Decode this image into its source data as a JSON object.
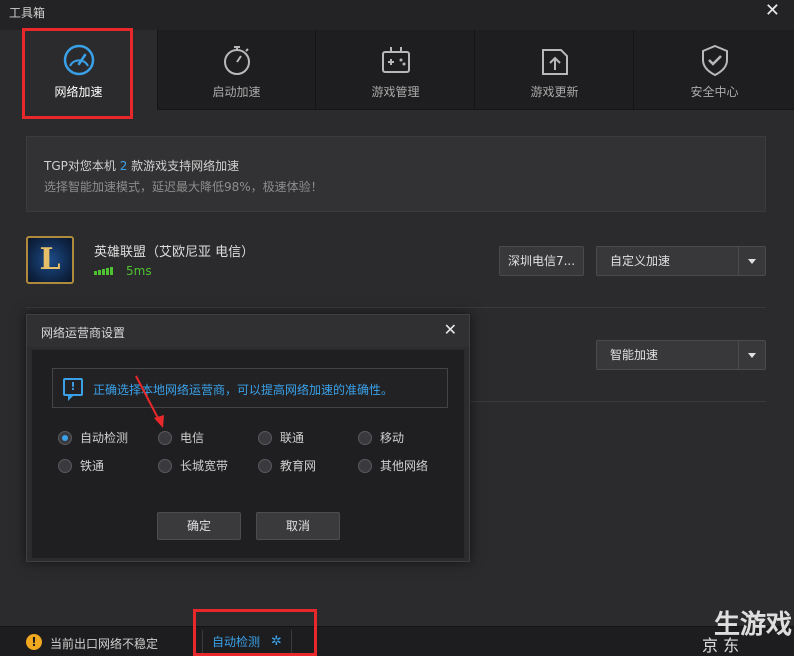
{
  "window": {
    "title": "工具箱"
  },
  "tabs": [
    {
      "label": "网络加速",
      "icon": "speedometer-icon",
      "active": true
    },
    {
      "label": "启动加速",
      "icon": "stopwatch-icon",
      "active": false
    },
    {
      "label": "游戏管理",
      "icon": "gamepad-icon",
      "active": false
    },
    {
      "label": "游戏更新",
      "icon": "upload-box-icon",
      "active": false
    },
    {
      "label": "安全中心",
      "icon": "shield-check-icon",
      "active": false
    }
  ],
  "notice": {
    "line1_prefix": "TGP对您本机",
    "line1_count": "2",
    "line1_suffix": "款游戏支持网络加速",
    "line2": "选择智能加速模式，延迟最大降低98%，极速体验！"
  },
  "games": [
    {
      "name": "英雄联盟（艾欧尼亚 电信）",
      "icon_letter": "L",
      "ping": "5ms",
      "signal_bars": 5,
      "server_button": "深圳电信7...",
      "mode": "自定义加速"
    },
    {
      "mode": "智能加速"
    }
  ],
  "dialog": {
    "title": "网络运营商设置",
    "tip": "正确选择本地网络运营商，可以提高网络加速的准确性。",
    "options": [
      {
        "label": "自动检测",
        "checked": true
      },
      {
        "label": "电信",
        "checked": false
      },
      {
        "label": "联通",
        "checked": false
      },
      {
        "label": "移动",
        "checked": false
      },
      {
        "label": "铁通",
        "checked": false
      },
      {
        "label": "长城宽带",
        "checked": false
      },
      {
        "label": "教育网",
        "checked": false
      },
      {
        "label": "其他网络",
        "checked": false
      }
    ],
    "confirm_label": "确定",
    "cancel_label": "取消"
  },
  "statusbar": {
    "warning": "当前出口网络不稳定",
    "auto_detect": "自动检测"
  },
  "watermark": {
    "line1": "生游戏",
    "line2": "京 东"
  },
  "colors": {
    "accent": "#3aa1e8",
    "highlight_box": "#e8282b",
    "ping": "#4ec230",
    "warning": "#f0a820"
  }
}
